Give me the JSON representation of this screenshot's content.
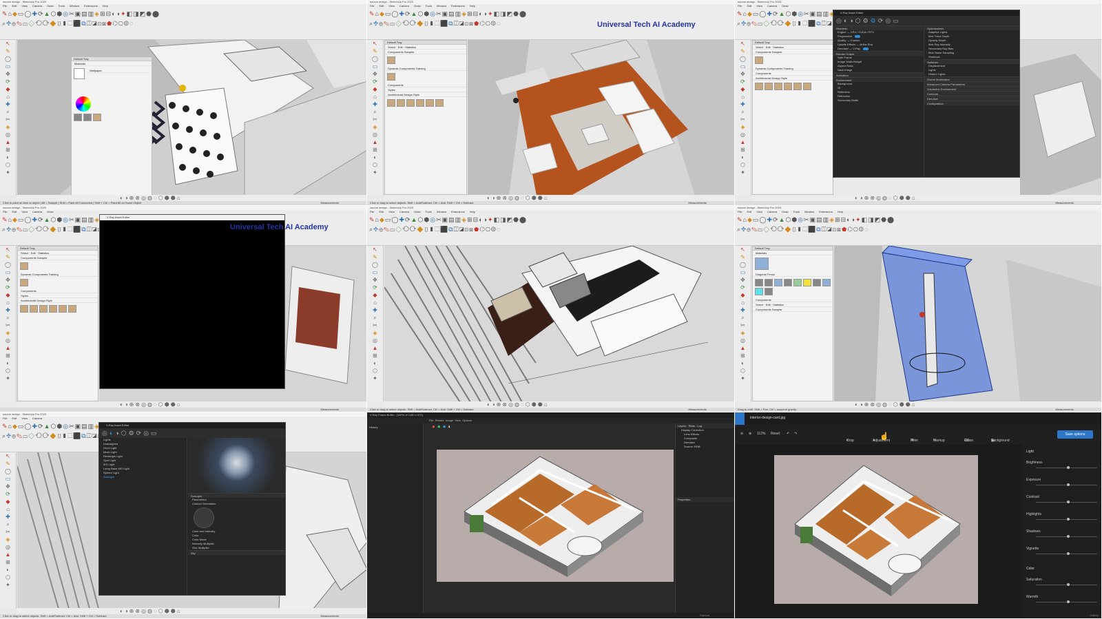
{
  "sketchup": {
    "window_title": "source design - SketchUp Pro 2023",
    "menu": [
      "File",
      "Edit",
      "View",
      "Camera",
      "Draw",
      "Tools",
      "Window",
      "Extensions",
      "Help"
    ],
    "status_select": "Click or drag to select objects. Shift = Add/Subtract. Ctrl = Add. Shift + Ctrl = Subtract.",
    "status_paint": "Click to paint an item or object | Alt = Sample | Shift = Paint All Connected | Shift + Ctrl = Paint All on Same Object",
    "status_orbit": "Drag to orbit. Shift = Pan, Ctrl = suspend gravity.",
    "measurements_label": "Measurements"
  },
  "watermark": "Universal Tech AI Academy",
  "tray": {
    "title": "Default Tray",
    "tabs": [
      "Select",
      "Edit",
      "Statistics"
    ],
    "components_title": "Components",
    "components": [
      "Components Sampler",
      "Dynamic Components Training"
    ],
    "styles_title": "Styles",
    "style_name": "Architectural Design Style",
    "materials_title": "Materials",
    "material_search": "Wallpaper",
    "material_name": "Diagonal Fence"
  },
  "vray_editor": {
    "title": "V-Ray Asset Editor",
    "sections": [
      "Renderer",
      "Render Output",
      "Animation",
      "Environment",
      "Global Illumination",
      "Advanced Camera Parameters",
      "Volumetric Environment",
      "Contours",
      "Denoiser",
      "Configuration"
    ],
    "renderer_rows": [
      {
        "label": "Engine",
        "value": "CPU / CUDA / RTX"
      },
      {
        "label": "Progressive",
        "value": ""
      },
      {
        "label": "Quality",
        "value": "Custom"
      },
      {
        "label": "Update Effects",
        "value": "At the End"
      },
      {
        "label": "Denoiser",
        "value": "V-Ray"
      }
    ],
    "output_rows": [
      "Safe Frame",
      "Image Width/Height",
      "Aspect Ratio",
      "Save Image"
    ],
    "env_rows": [
      "Background",
      "GI",
      "Reflection",
      "Refraction",
      "Secondary Matte"
    ],
    "right_sections": [
      "Optimizations",
      "Switches",
      "Global Illumination"
    ],
    "right_rows": [
      "Adaptive Lights",
      "Max Trace Depth",
      "Opacity Depth",
      "Max Ray Intensity",
      "Secondary Ray Bias",
      "Blue Noise Sampling",
      "Shadows",
      "Displacement",
      "Lights",
      "Hidden Lights"
    ],
    "lights_title": "Lights",
    "lights": [
      "Unassigned",
      "Omni Light",
      "Mesh Light",
      "Rectangle Light",
      "Spot Light",
      "IES Light",
      "Lamp Base WD Light",
      "Sphere Light",
      "SunLight"
    ],
    "sunlight_title": "SunLight",
    "sunlight_params": "Parameters",
    "custom_orientation": "Custom Orientation",
    "color_intensity": "Color and Intensity",
    "sun_rows": [
      "Color",
      "Color Mode",
      "Intensity Multiplier",
      "Size Multiplier"
    ],
    "sky": "Sky"
  },
  "frame_buffer": {
    "title": "V-Ray Frame Buffer - [100% of 1280 x 672]",
    "menu": [
      "File",
      "Render",
      "Image",
      "View",
      "Options"
    ],
    "left_tab": "History",
    "layers_tab": "Layers",
    "stats_tab": "Stats",
    "log_tab": "Log",
    "layers": [
      "Display Correction",
      "Lens Effects",
      "Composite",
      "Denoiser",
      "Source: RGB"
    ],
    "properties": "Properties",
    "status": "Gamma"
  },
  "image_editor": {
    "file_name": "interior-design-card.jpg",
    "zoom": "112%",
    "reset": "Reset",
    "tools": [
      "Crop",
      "Adjustment",
      "Filter",
      "Markup",
      "Erase",
      "Background"
    ],
    "save_button": "Save options",
    "light_section": "Light",
    "light_items": [
      {
        "label": "Brightness",
        "value": 0.5
      },
      {
        "label": "Exposure",
        "value": 0.5
      },
      {
        "label": "Contrast",
        "value": 0.5
      },
      {
        "label": "Highlights",
        "value": 0.5
      },
      {
        "label": "Shadows",
        "value": 0.5
      },
      {
        "label": "Vignette",
        "value": 0.5
      }
    ],
    "color_section": "Color",
    "color_items": [
      {
        "label": "Saturation",
        "value": 0.5
      },
      {
        "label": "Warmth",
        "value": 0.5
      }
    ],
    "bottom_label": "Gallery"
  }
}
